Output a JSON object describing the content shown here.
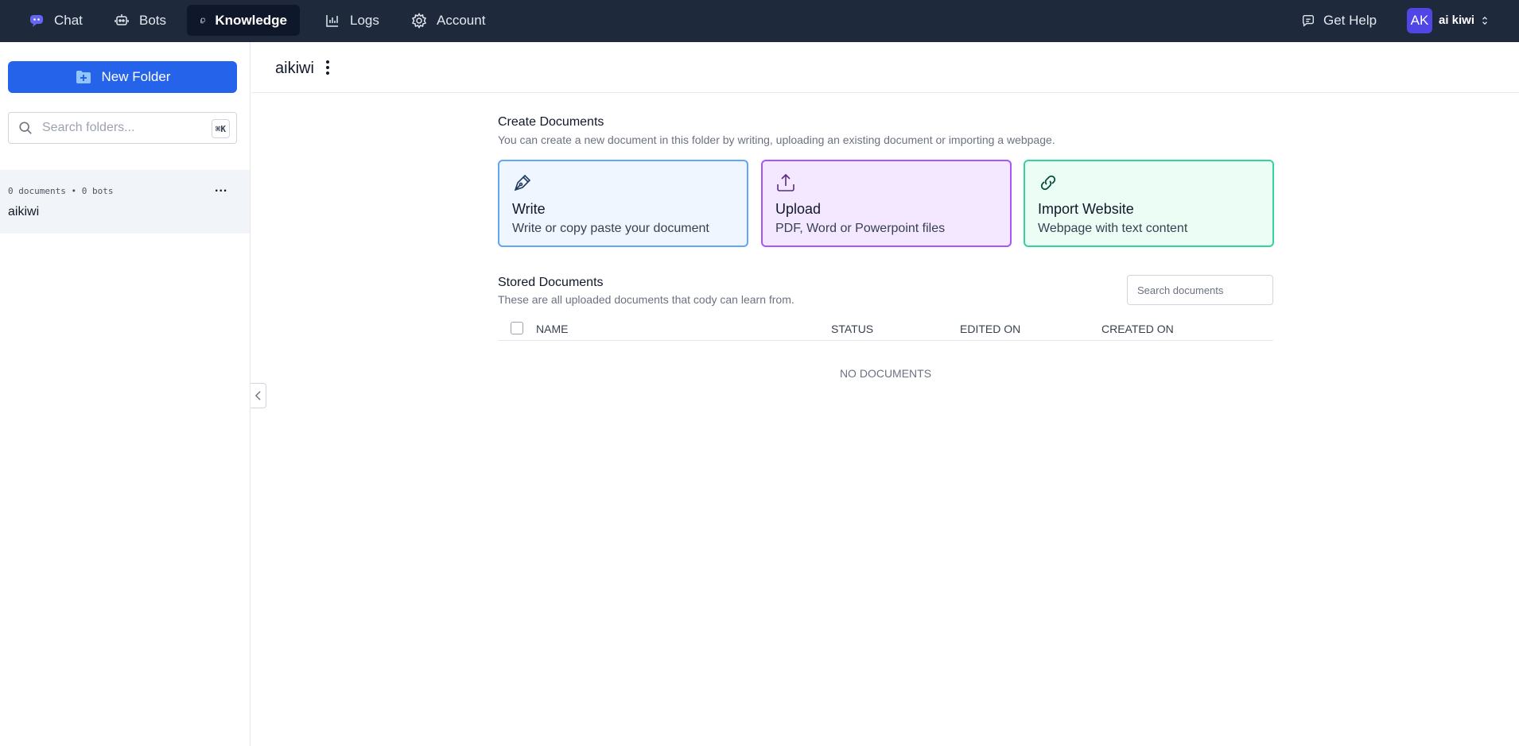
{
  "nav": {
    "items": [
      {
        "label": "Chat",
        "icon": "chat-bubble-icon"
      },
      {
        "label": "Bots",
        "icon": "bot-icon"
      },
      {
        "label": "Knowledge",
        "icon": "copy-documents-icon",
        "active": true
      },
      {
        "label": "Logs",
        "icon": "chart-icon"
      },
      {
        "label": "Account",
        "icon": "gear-icon"
      }
    ],
    "help_label": "Get Help",
    "user": {
      "initials": "AK",
      "name": "ai kiwi"
    }
  },
  "sidebar": {
    "new_folder_label": "New Folder",
    "search_placeholder": "Search folders...",
    "shortcut": "⌘K",
    "folders": [
      {
        "meta": "0 documents • 0 bots",
        "name": "aikiwi",
        "menu": "..."
      }
    ]
  },
  "main": {
    "folder_title": "aikiwi",
    "create": {
      "title": "Create Documents",
      "subtitle": "You can create a new document in this folder by writing, uploading an existing document or importing a webpage.",
      "cards": [
        {
          "title": "Write",
          "desc": "Write or copy paste your document",
          "icon": "pen-icon"
        },
        {
          "title": "Upload",
          "desc": "PDF, Word or Powerpoint files",
          "icon": "upload-icon"
        },
        {
          "title": "Import Website",
          "desc": "Webpage with text content",
          "icon": "link-icon"
        }
      ]
    },
    "stored": {
      "title": "Stored Documents",
      "subtitle": "These are all uploaded documents that cody can learn from.",
      "search_placeholder": "Search documents",
      "columns": [
        "NAME",
        "STATUS",
        "EDITED ON",
        "CREATED ON"
      ],
      "empty_text": "NO DOCUMENTS"
    }
  },
  "colors": {
    "topbar": "#1e293b",
    "primary": "#2563eb",
    "write_border": "#60a5fa",
    "upload_border": "#a855f7",
    "import_border": "#34d399"
  }
}
